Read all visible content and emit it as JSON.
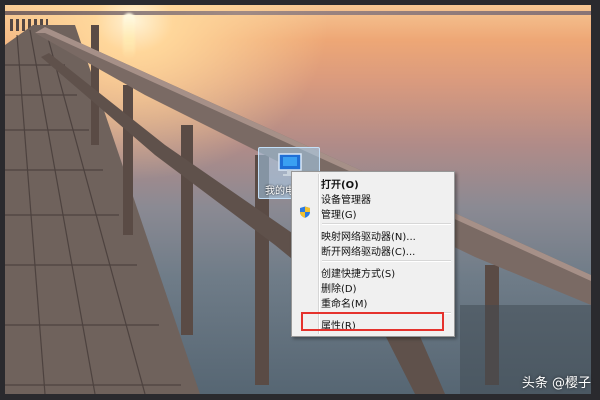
{
  "desktop": {
    "icon": {
      "label": "我的电",
      "icon": "computer-icon"
    }
  },
  "context_menu": {
    "items": [
      {
        "label": "打开(O)",
        "bold": true
      },
      {
        "label": "设备管理器"
      },
      {
        "label": "管理(G)",
        "icon": "uac-shield-icon"
      },
      {
        "label": "映射网络驱动器(N)..."
      },
      {
        "label": "断开网络驱动器(C)..."
      },
      {
        "label": "创建快捷方式(S)"
      },
      {
        "label": "删除(D)"
      },
      {
        "label": "重命名(M)"
      },
      {
        "label": "属性(R)",
        "highlighted": true
      }
    ]
  },
  "watermark": {
    "text": "头条 @樱子"
  },
  "colors": {
    "highlight": "#e5322d",
    "menu_bg": "#f0f0f0"
  }
}
